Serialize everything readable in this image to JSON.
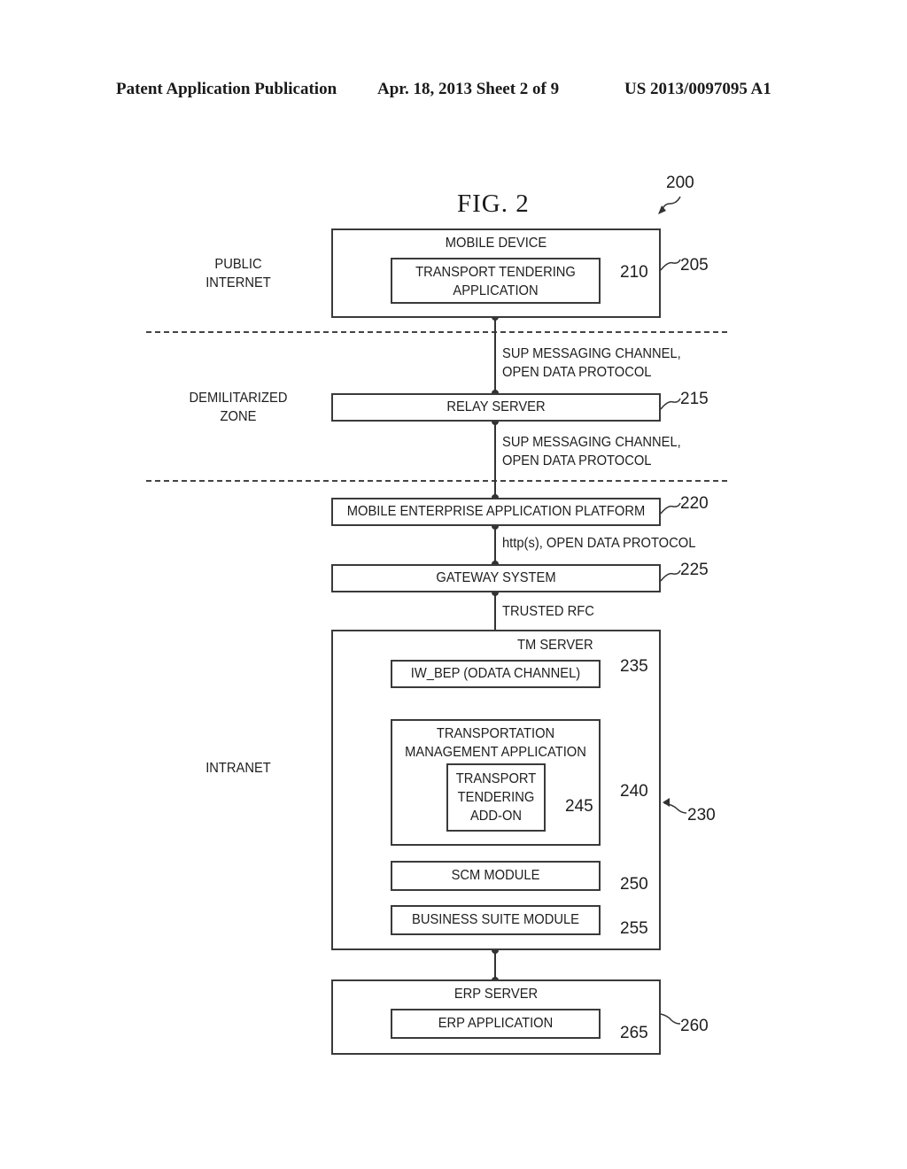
{
  "header": {
    "publication": "Patent Application Publication",
    "date_sheet": "Apr. 18, 2013  Sheet 2 of 9",
    "patent_number": "US 2013/0097095 A1"
  },
  "figure": {
    "title": "FIG. 2",
    "ref": "200"
  },
  "zones": {
    "public": "PUBLIC\nINTERNET",
    "dmz": "DEMILITARIZED\nZONE",
    "intranet": "INTRANET"
  },
  "blocks": {
    "mobile_device": {
      "label": "MOBILE DEVICE",
      "ref": "205"
    },
    "tt_app": {
      "label": "TRANSPORT TENDERING\nAPPLICATION",
      "ref": "210"
    },
    "relay": {
      "label": "RELAY SERVER",
      "ref": "215"
    },
    "meap": {
      "label": "MOBILE ENTERPRISE APPLICATION PLATFORM",
      "ref": "220"
    },
    "gateway": {
      "label": "GATEWAY SYSTEM",
      "ref": "225"
    },
    "tm_server": {
      "label": "TM SERVER",
      "ref": "230"
    },
    "iw_bep": {
      "label": "IW_BEP (ODATA CHANNEL)",
      "ref": "235"
    },
    "tm_app": {
      "label": "TRANSPORTATION\nMANAGEMENT APPLICATION",
      "ref": "240"
    },
    "tt_addon": {
      "label": "TRANSPORT\nTENDERING\nADD-ON",
      "ref": "245"
    },
    "scm": {
      "label": "SCM MODULE",
      "ref": "250"
    },
    "bsm": {
      "label": "BUSINESS SUITE MODULE",
      "ref": "255"
    },
    "erp_server": {
      "label": "ERP SERVER",
      "ref": "260"
    },
    "erp_app": {
      "label": "ERP APPLICATION",
      "ref": "265"
    }
  },
  "connections": {
    "sup1": "SUP MESSAGING CHANNEL,\nOPEN DATA PROTOCOL",
    "sup2": "SUP MESSAGING CHANNEL,\nOPEN DATA PROTOCOL",
    "http": "http(s), OPEN DATA PROTOCOL",
    "rfc": "TRUSTED RFC"
  }
}
